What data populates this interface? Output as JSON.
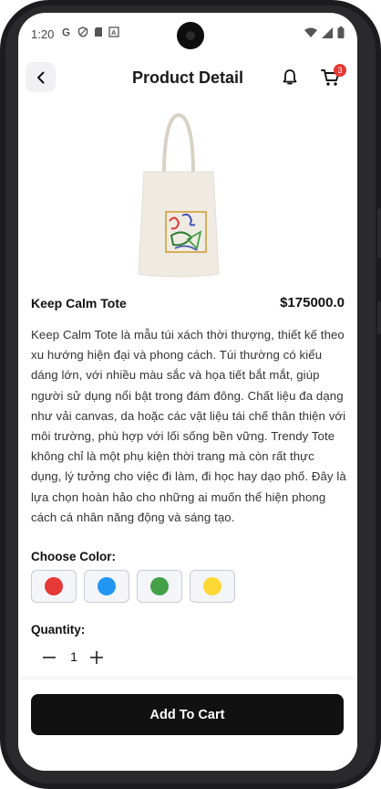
{
  "status_bar": {
    "time": "1:20",
    "left_icons": [
      "google-icon",
      "shield-icon",
      "sd-card-icon",
      "font-icon"
    ],
    "right_icons": [
      "wifi-icon",
      "signal-icon",
      "battery-icon"
    ]
  },
  "header": {
    "title": "Product Detail",
    "cart_badge": "3"
  },
  "product": {
    "name": "Keep Calm Tote",
    "price": "$175000.0",
    "description": "Keep Calm Tote là mẫu túi xách thời thượng, thiết kế theo xu hướng hiện đại và phong cách. Túi thường có kiểu dáng lớn, với nhiều màu sắc và họa tiết bắt mắt, giúp người sử dụng nổi bật trong đám đông. Chất liệu đa dạng như vải canvas, da hoặc các vật liệu tái chế thân thiện với môi trường, phù hợp với lối sống bền vững. Trendy Tote không chỉ là một phụ kiện thời trang mà còn rất thực dụng, lý tưởng cho việc đi làm, đi học hay dạo phố. Đây là lựa chọn hoàn hảo cho những ai muốn thể hiện phong cách cá nhân năng động và sáng tạo."
  },
  "color_section": {
    "label": "Choose Color:",
    "colors": [
      "#e53935",
      "#2196f3",
      "#43a047",
      "#fdd835"
    ]
  },
  "quantity_section": {
    "label": "Quantity:",
    "value": "1"
  },
  "actions": {
    "add_to_cart": "Add To Cart"
  }
}
